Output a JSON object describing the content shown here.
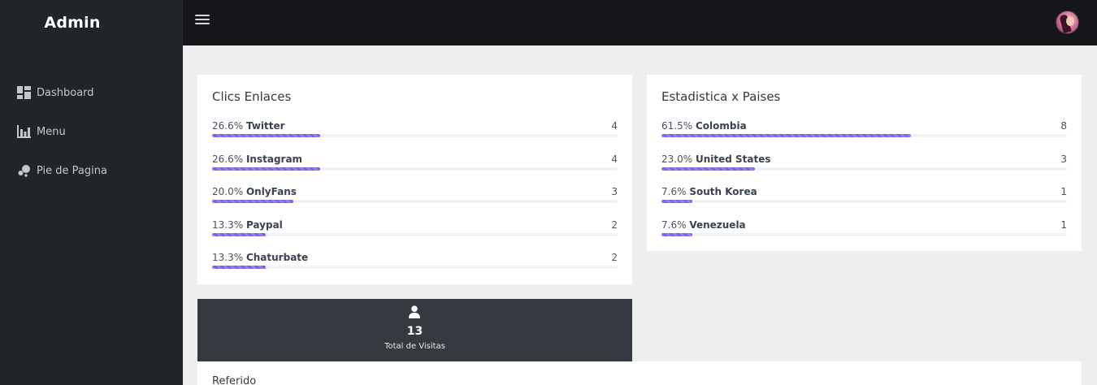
{
  "brand": "Admin",
  "sidebar": {
    "items": [
      {
        "label": "Dashboard",
        "icon": "dashboard-icon"
      },
      {
        "label": "Menu",
        "icon": "bar-chart-icon"
      },
      {
        "label": "Pie de Pagina",
        "icon": "bubbles-icon"
      }
    ]
  },
  "topbar": {
    "menu_icon": "hamburger-icon",
    "avatar": "user-avatar"
  },
  "clics": {
    "title": "Clics Enlaces",
    "rows": [
      {
        "pct": "26.6%",
        "name": "Twitter",
        "count": "4",
        "fraction": 0.266
      },
      {
        "pct": "26.6%",
        "name": "Instagram",
        "count": "4",
        "fraction": 0.266
      },
      {
        "pct": "20.0%",
        "name": "OnlyFans",
        "count": "3",
        "fraction": 0.2
      },
      {
        "pct": "13.3%",
        "name": "Paypal",
        "count": "2",
        "fraction": 0.133
      },
      {
        "pct": "13.3%",
        "name": "Chaturbate",
        "count": "2",
        "fraction": 0.133
      }
    ]
  },
  "paises": {
    "title": "Estadistica x Paises",
    "rows": [
      {
        "pct": "61.5%",
        "name": "Colombia",
        "count": "8",
        "fraction": 0.615
      },
      {
        "pct": "23.0%",
        "name": "United States",
        "count": "3",
        "fraction": 0.23
      },
      {
        "pct": "7.6%",
        "name": "South Korea",
        "count": "1",
        "fraction": 0.076
      },
      {
        "pct": "7.6%",
        "name": "Venezuela",
        "count": "1",
        "fraction": 0.076
      }
    ]
  },
  "visits": {
    "icon": "user-icon",
    "value": "13",
    "label": "Total de Visitas"
  },
  "referido": {
    "title": "Referido"
  },
  "colors": {
    "accent": "#7b61e6",
    "sidebar": "#212529",
    "topbar": "#15161a",
    "stat_card": "#343a40"
  }
}
